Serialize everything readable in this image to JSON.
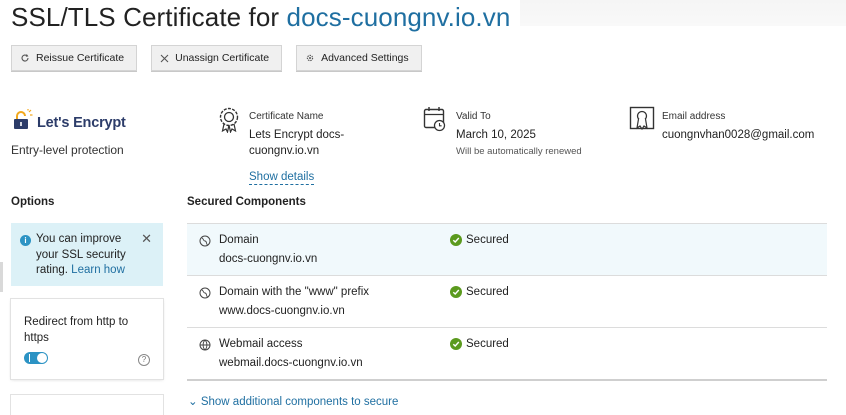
{
  "page": {
    "title_prefix": "SSL/TLS Certificate for ",
    "title_domain": "docs-cuongnv.io.vn"
  },
  "toolbar": {
    "reissue_label": "Reissue Certificate",
    "unassign_label": "Unassign Certificate",
    "advanced_label": "Advanced Settings"
  },
  "provider": {
    "name": "Let's Encrypt",
    "subtitle": "Entry-level protection"
  },
  "certificate": {
    "name_label": "Certificate Name",
    "name_line1": "Lets Encrypt docs-",
    "name_line2": "cuongnv.io.vn",
    "show_details": "Show details",
    "valid_label": "Valid To",
    "valid_value": "March 10, 2025",
    "valid_note": "Will be automatically renewed",
    "email_label": "Email address",
    "email_value": "cuongnvhan0028@gmail.com"
  },
  "options": {
    "header": "Options",
    "tip_text": "You can improve your SSL security rating.",
    "tip_link": "Learn how",
    "redirect_label": "Redirect from http to https",
    "redirect_enabled": true
  },
  "secured": {
    "header": "Secured Components",
    "rows": [
      {
        "name": "Domain",
        "domain": "docs-cuongnv.io.vn",
        "status": "Secured"
      },
      {
        "name": "Domain with the \"www\" prefix",
        "domain": "www.docs-cuongnv.io.vn",
        "status": "Secured"
      },
      {
        "name": "Webmail access",
        "domain": "webmail.docs-cuongnv.io.vn",
        "status": "Secured"
      }
    ],
    "more_link": "Show additional components to secure"
  },
  "colors": {
    "accent": "#1f6fa1",
    "success": "#5b9a1e",
    "tip_bg": "#dcf1f7",
    "row_highlight": "#f1f9fc"
  },
  "icons": [
    "reissue-icon",
    "close-icon",
    "gear-icon",
    "lock-icon",
    "certificate-icon",
    "calendar-icon",
    "email-certificate-icon",
    "info-icon",
    "help-icon",
    "globe-icon",
    "check-icon",
    "chevron-down-icon"
  ]
}
